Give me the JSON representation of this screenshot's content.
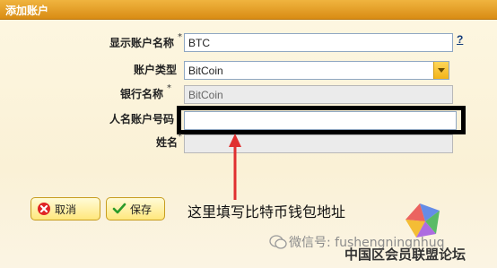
{
  "window": {
    "title": "添加账户"
  },
  "form": {
    "display_name": {
      "label": "显示账户名称",
      "required_mark": "*",
      "value": "BTC",
      "help": "?"
    },
    "account_type": {
      "label": "账户类型",
      "value": "BitCoin"
    },
    "bank_name": {
      "label": "银行名称",
      "required_mark": "*",
      "value": "BitCoin"
    },
    "account_number": {
      "label": "人名账户号码",
      "value": ""
    },
    "name": {
      "label": "姓名",
      "required_mark": "*",
      "value": ""
    }
  },
  "buttons": {
    "cancel": {
      "label": "取消",
      "icon": "red-x-icon"
    },
    "save": {
      "label": "保存",
      "icon": "green-check-icon"
    }
  },
  "annotation": {
    "text": "这里填写比特币钱包地址",
    "highlight_color": "#000000",
    "arrow_color": "#e03030"
  },
  "watermarks": {
    "wechat": "微信号: fushengningnhuq",
    "forum": "中国区会员联盟论坛"
  },
  "colors": {
    "titlebar": "#e2a02a",
    "button_fill": "#ffec90",
    "input_border": "#8fa7c2"
  }
}
